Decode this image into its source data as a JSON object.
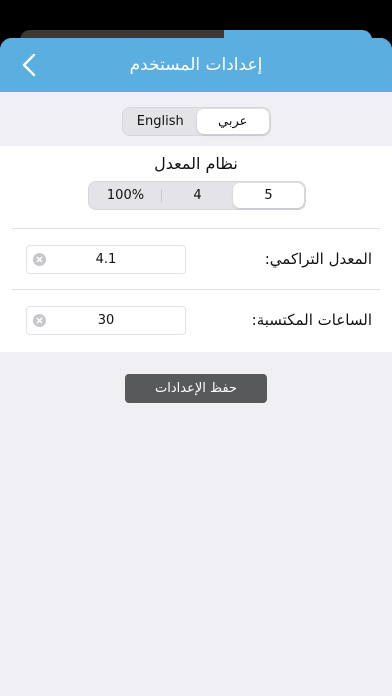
{
  "colors": {
    "nav_bar": "#5aaee0",
    "background": "#efeff4",
    "save_button": "#58595b"
  },
  "nav": {
    "title": "إعدادات المستخدم",
    "back_icon": "chevron-left-icon"
  },
  "language": {
    "options": [
      "English",
      "عربي"
    ],
    "selected": "عربي"
  },
  "rate_system": {
    "title": "نظام المعدل",
    "options": [
      "100%",
      "4",
      "5"
    ],
    "selected": "5"
  },
  "gpa": {
    "label": "المعدل التراكمي:",
    "value": "4.1"
  },
  "hours": {
    "label": "الساعات المكتسبة:",
    "value": "30"
  },
  "save_label": "حفظ الإعدادات"
}
